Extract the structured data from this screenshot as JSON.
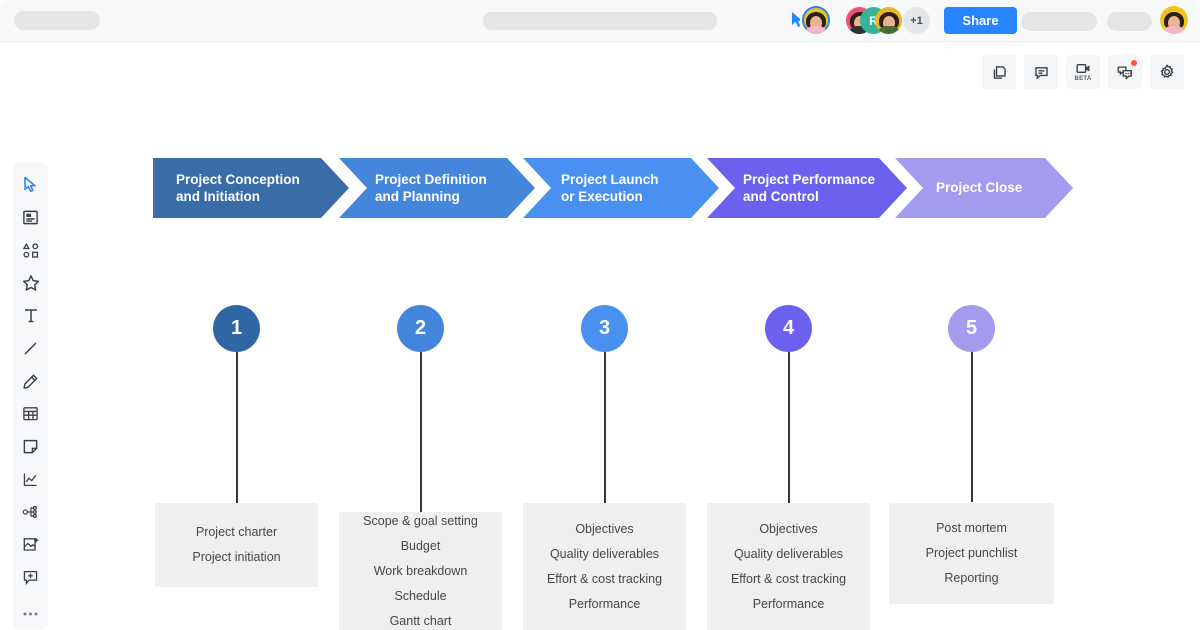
{
  "topbar": {
    "share_label": "Share",
    "plus_count": "+1",
    "initial_avatar": "R",
    "placeholders": [
      "",
      "",
      "",
      ""
    ]
  },
  "right_toolbar": {
    "items": [
      {
        "name": "pages-icon",
        "label": ""
      },
      {
        "name": "comment-icon",
        "label": ""
      },
      {
        "name": "video-icon",
        "label": "BETA"
      },
      {
        "name": "chat-icon",
        "label": ""
      },
      {
        "name": "gear-icon",
        "label": ""
      }
    ]
  },
  "left_toolbar": {
    "items": [
      {
        "name": "cursor-select-icon"
      },
      {
        "name": "template-icon"
      },
      {
        "name": "shapes-icon"
      },
      {
        "name": "star-icon"
      },
      {
        "name": "text-icon"
      },
      {
        "name": "line-icon"
      },
      {
        "name": "pen-icon"
      },
      {
        "name": "table-icon"
      },
      {
        "name": "sticky-note-icon"
      },
      {
        "name": "chart-icon"
      },
      {
        "name": "mindmap-icon"
      },
      {
        "name": "image-add-icon"
      },
      {
        "name": "comment-add-icon"
      },
      {
        "name": "more-options-icon"
      }
    ]
  },
  "diagram": {
    "phases": [
      {
        "label": "Project Conception\nand Initiation",
        "color": "#3a6ca8",
        "circle_color": "#2f67a5",
        "box_color": "#efefef"
      },
      {
        "label": "Project Definition\nand Planning",
        "color": "#4586dd",
        "circle_color": "#4586dd",
        "box_color": "#efefef"
      },
      {
        "label": "Project Launch\nor Execution",
        "color": "#4a90f0",
        "circle_color": "#4a90f0",
        "box_color": "#efefef"
      },
      {
        "label": "Project Performance\nand Control",
        "color": "#6a62ee",
        "circle_color": "#6a62ee",
        "box_color": "#efefef"
      },
      {
        "label": "Project Close",
        "color": "#a29bee",
        "circle_color": "#a29bee",
        "box_color": "#efefef"
      }
    ],
    "steps": [
      {
        "number": "1",
        "items": [
          "Project charter",
          "Project initiation"
        ]
      },
      {
        "number": "2",
        "items": [
          "Scope & goal setting",
          "Budget",
          "Work breakdown",
          "Schedule",
          "Gantt chart"
        ]
      },
      {
        "number": "3",
        "items": [
          "Objectives",
          "Quality deliverables",
          "Effort & cost tracking",
          "Performance"
        ]
      },
      {
        "number": "4",
        "items": [
          "Objectives",
          "Quality deliverables",
          "Effort & cost tracking",
          "Performance"
        ]
      },
      {
        "number": "5",
        "items": [
          "Post mortem",
          "Project punchlist",
          "Reporting"
        ]
      }
    ]
  },
  "colors": {
    "accent": "#2684ff",
    "canvas": "#ffffff",
    "chrome": "#f7f8f9",
    "box_bg": "#efefef",
    "stem": "#33363b"
  }
}
